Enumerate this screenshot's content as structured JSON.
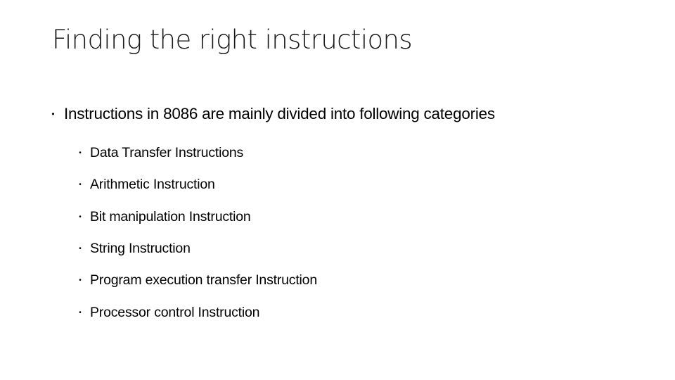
{
  "slide": {
    "title": "Finding the right instructions",
    "bullet_glyph": "•",
    "main_point": "Instructions in 8086 are mainly divided into following categories",
    "categories": [
      "Data Transfer Instructions",
      "Arithmetic Instruction",
      "Bit manipulation Instruction",
      "String Instruction",
      "Program execution transfer Instruction",
      "Processor control Instruction"
    ]
  }
}
